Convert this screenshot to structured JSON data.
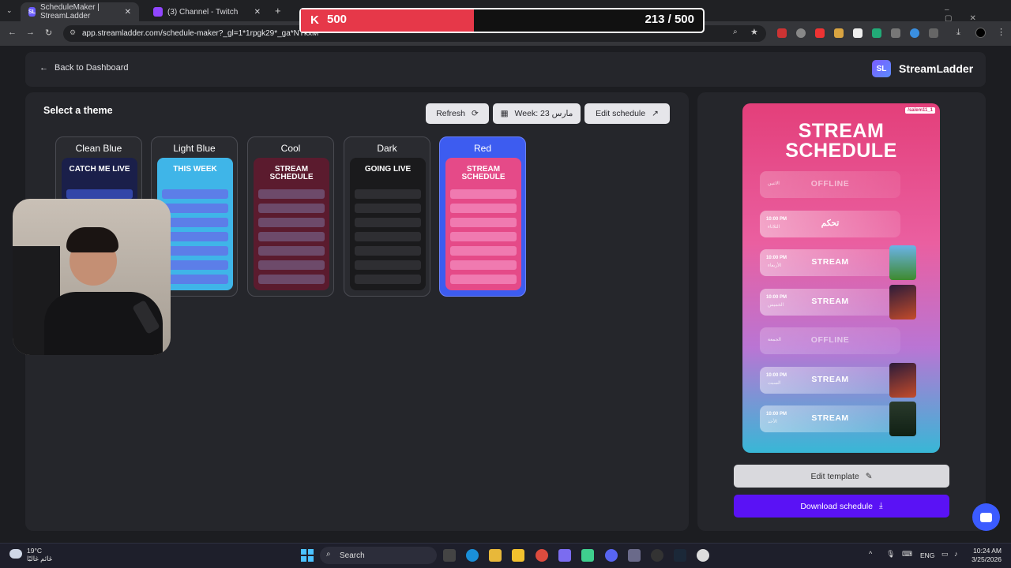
{
  "browser": {
    "tabs": [
      {
        "title": "ScheduleMaker | StreamLadder",
        "favicon": "SL",
        "active": true
      },
      {
        "title": "(3) Channel - Twitch",
        "favicon": "twitch-icon",
        "active": false
      }
    ],
    "new_tab": "+",
    "url": "app.streamladder.com/schedule-maker?_gl=1*1rpgk29*_ga*NTkxM"
  },
  "overlay": {
    "goal_icon": "K",
    "goal_current_label": "500",
    "goal_progress": "213 / 500",
    "goal_fraction": 0.43
  },
  "header": {
    "back_label": "Back to Dashboard",
    "brand_badge": "SL",
    "brand_name": "StreamLadder"
  },
  "themes": {
    "heading": "Select a theme",
    "refresh_label": "Refresh",
    "week_label": "Week: 23 مارس",
    "edit_schedule_label": "Edit schedule",
    "cards": [
      {
        "name": "Clean Blue",
        "thumb_title": "CATCH ME LIVE",
        "selected": false,
        "bg": "#1a1f4a",
        "row": "#3346a8"
      },
      {
        "name": "Light Blue",
        "thumb_title": "THIS WEEK",
        "selected": false,
        "bg": "#3fb5e8",
        "row": "#5c7ee8"
      },
      {
        "name": "Cool",
        "thumb_title": "STREAM SCHEDULE",
        "selected": false,
        "bg": "#5b1b2e",
        "row": "#6d4a6a"
      },
      {
        "name": "Dark",
        "thumb_title": "GOING LIVE",
        "selected": false,
        "bg": "#1a1a1c",
        "row": "#2e2e32"
      },
      {
        "name": "Red",
        "thumb_title": "STREAM SCHEDULE",
        "selected": true,
        "bg": "#e54a88",
        "row": "#f07ab0"
      }
    ]
  },
  "preview": {
    "handle": "/salem11_1",
    "title_line1": "STREAM",
    "title_line2": "SCHEDULE",
    "rows": [
      {
        "time": "",
        "day": "الاثنين",
        "label": "OFFLINE",
        "offline": true,
        "image": ""
      },
      {
        "time": "10:00 PM",
        "day": "الثلاثاء",
        "label": "تحكم",
        "offline": false,
        "image": ""
      },
      {
        "time": "10:00 PM",
        "day": "الأربعاء",
        "label": "STREAM",
        "offline": false,
        "image": "minecraft"
      },
      {
        "time": "10:00 PM",
        "day": "الخميس",
        "label": "STREAM",
        "offline": false,
        "image": "arc-raiders"
      },
      {
        "time": "",
        "day": "الجمعة",
        "label": "OFFLINE",
        "offline": true,
        "image": ""
      },
      {
        "time": "10:00 PM",
        "day": "السبت",
        "label": "STREAM",
        "offline": false,
        "image": "arc-raiders"
      },
      {
        "time": "10:00 PM",
        "day": "الأحد",
        "label": "STREAM",
        "offline": false,
        "image": "deadlock"
      }
    ],
    "edit_template_label": "Edit template",
    "download_label": "Download schedule"
  },
  "taskbar": {
    "temp": "19°C",
    "weather_desc": "غائم غالبًا",
    "search_label": "Search",
    "lang": "ENG",
    "time": "10:24 AM",
    "date": "3/25/2026"
  },
  "colors": {
    "accent": "#5a12f5",
    "selected_card": "#3d5cf0",
    "goal_bar": "#e63849"
  }
}
